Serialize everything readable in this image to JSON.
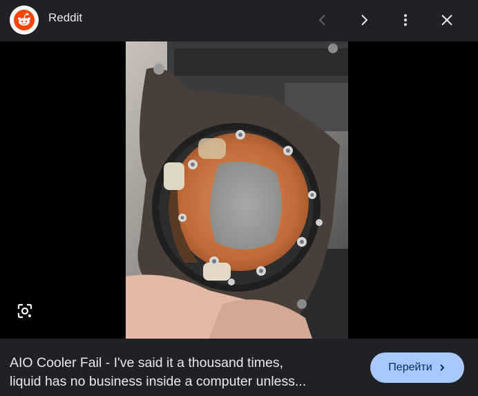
{
  "header": {
    "site_name": "Reddit",
    "site_icon": "reddit-alien-icon",
    "buttons": [
      "chevron-left-icon",
      "chevron-right-icon",
      "more-vert-icon",
      "close-icon"
    ]
  },
  "viewer": {
    "lens_icon": "google-lens-icon"
  },
  "footer": {
    "caption_line1": "AIO Cooler Fail - I've said it a thousand times,",
    "caption_line2": "liquid has no business inside a computer unless...",
    "visit_label": "Перейти",
    "visit_icon": "chevron-right-icon"
  },
  "colors": {
    "background": "#202124",
    "button_bg": "#a8c7fa",
    "button_text": "#062e6f",
    "brand": "#ff4500"
  }
}
